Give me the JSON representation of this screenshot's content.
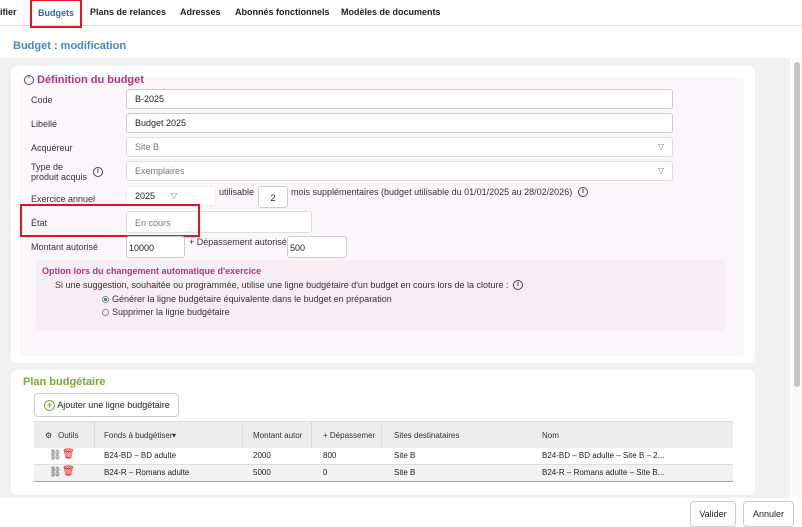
{
  "tabs": [
    "ifier",
    "Budgets",
    "Plans de relances",
    "Adresses",
    "Abonnés fonctionnels",
    "Modèles de documents"
  ],
  "page_title": "Budget : modification",
  "definition": {
    "title": "Définition du budget",
    "code_label": "Code",
    "code_value": "B-2025",
    "libelle_label": "Libellé",
    "libelle_value": "Budget 2025",
    "acquereur_label": "Acquéreur",
    "acquereur_value": "Site B",
    "type_label_1": "Type de",
    "type_label_2": "produit acquis",
    "type_value": "Exemplaires",
    "exercice_label": "Exercice annuel",
    "exercice_value": "2025",
    "utilisable_label": "utilisable",
    "mois_value": "2",
    "mois_text": "mois supplémentaires (budget utilisable du 01/01/2025 au 28/02/2026)",
    "etat_label": "État",
    "etat_value": "En cours",
    "montant_label": "Montant autorisé",
    "montant_value": "10000",
    "depassement_label": "+ Dépassement autorisé",
    "depassement_value": "500"
  },
  "option": {
    "title": "Option lors du changement automatique d'exercice",
    "text": "Si une suggestion, souhaitée ou programmée, utilise une ligne budgétaire d'un budget en cours lors de la cloture :",
    "radio1": "Générer la ligne budgétaire équivalente dans le budget en préparation",
    "radio2": "Supprimer la ligne budgétaire"
  },
  "plan": {
    "title": "Plan budgétaire",
    "add_button": "Ajouter une ligne budgétaire",
    "headers": {
      "outils": "Outils",
      "fonds": "Fonds à budgétiser",
      "montant": "Montant autor",
      "depassement": "+ Dépassemer",
      "sites": "Sites destinataires",
      "nom": "Nom"
    },
    "rows": [
      {
        "fonds": "B24-BD – BD adulte",
        "montant": "2000",
        "depassement": "800",
        "sites": "Site B",
        "nom": "B24-BD – BD adulte – Site B – 2..."
      },
      {
        "fonds": "B24-R – Romans adulte",
        "montant": "5000",
        "depassement": "0",
        "sites": "Site B",
        "nom": "B24-R – Romans adulte – Site B..."
      }
    ]
  },
  "footer": {
    "valider": "Valider",
    "annuler": "Annuler"
  }
}
